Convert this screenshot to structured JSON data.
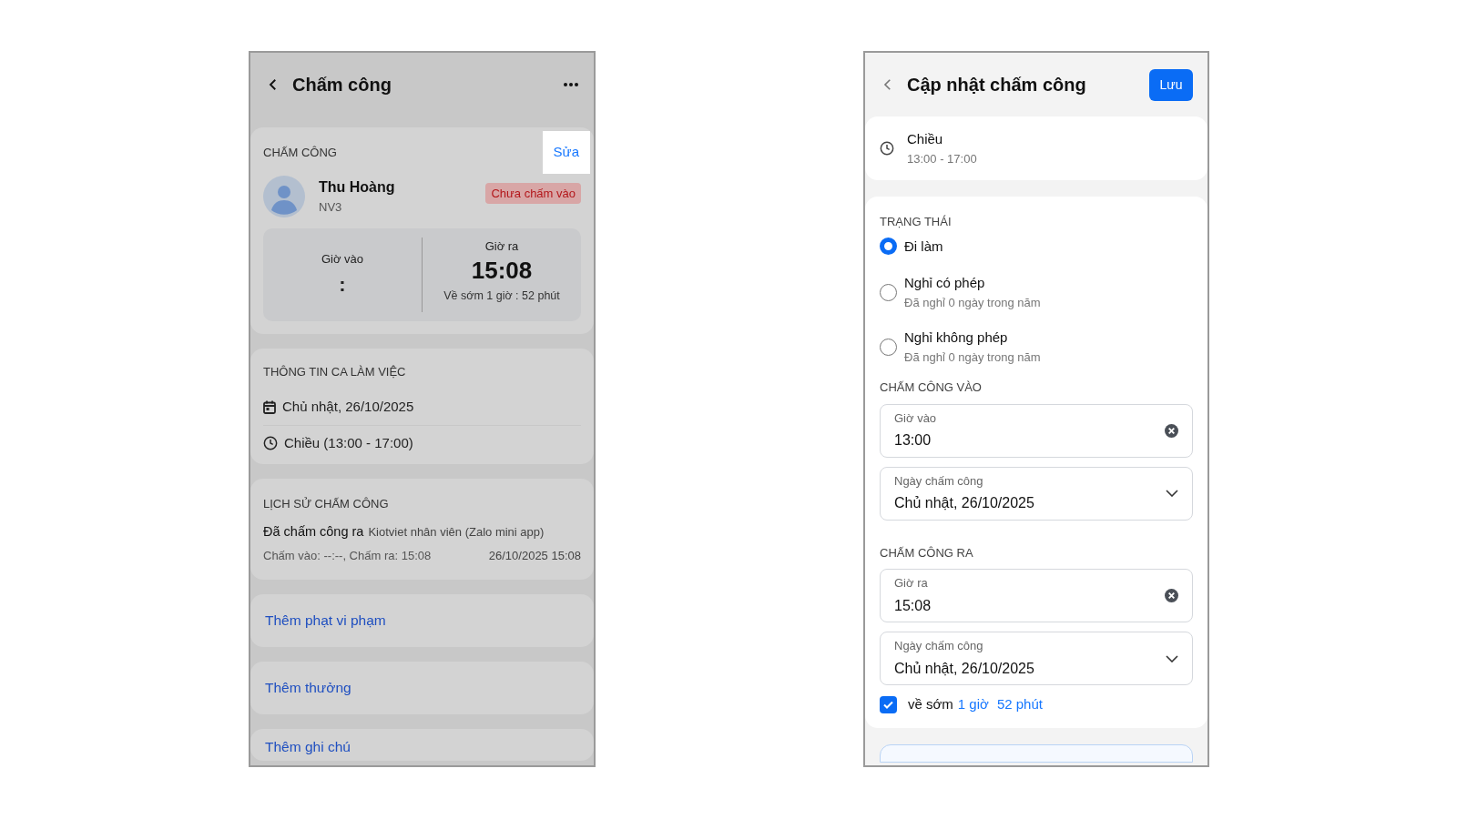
{
  "attendance_screen": {
    "dimmed": true,
    "title": "Chấm công",
    "attendance_card": {
      "heading": "CHẤM CÔNG",
      "edit_link": {
        "label": "Sửa",
        "highlighted": true
      },
      "employee": {
        "name": "Thu Hoàng",
        "code": "NV3"
      },
      "status_badge": "Chưa chấm vào",
      "clock_in": {
        "label": "Giờ vào",
        "value": ":"
      },
      "clock_out": {
        "label": "Giờ ra",
        "value": "15:08",
        "note": "Về sớm 1 giờ : 52 phút"
      }
    },
    "shift_card": {
      "heading": "THÔNG TIN CA LÀM VIỆC",
      "date": "Chủ nhật, 26/10/2025",
      "shift": "Chiều (13:00 - 17:00)"
    },
    "history_card": {
      "heading": "LỊCH SỬ CHẤM CÔNG",
      "entries": [
        {
          "action": "Đã chấm công ra",
          "source": "Kiotviet nhân viên (Zalo mini app)",
          "detail": "Chấm vào: --:--, Chấm ra: 15:08",
          "timestamp": "26/10/2025 15:08"
        }
      ]
    },
    "actions": [
      "Thêm phạt vi phạm",
      "Thêm thưởng",
      "Thêm ghi chú"
    ]
  },
  "edit_screen": {
    "title": "Cập nhật chấm công",
    "save_button": "Lưu",
    "shift": {
      "name": "Chiều",
      "time": "13:00 - 17:00"
    },
    "status": {
      "heading": "TRẠNG THÁI",
      "options": [
        {
          "label": "Đi làm",
          "selected": true
        },
        {
          "label": "Nghỉ có phép",
          "note": "Đã nghỉ 0 ngày trong năm",
          "selected": false
        },
        {
          "label": "Nghỉ không phép",
          "note": "Đã nghỉ 0 ngày trong năm",
          "selected": false
        }
      ]
    },
    "sections": [
      {
        "heading": "CHẤM CÔNG VÀO",
        "fields": [
          {
            "kind": "time",
            "label": "Giờ vào",
            "value": "13:00"
          },
          {
            "kind": "date",
            "label": "Ngày chấm công",
            "value": "Chủ nhật, 26/10/2025"
          }
        ]
      },
      {
        "heading": "CHẤM CÔNG RA",
        "fields": [
          {
            "kind": "time",
            "label": "Giờ ra",
            "value": "15:08"
          },
          {
            "kind": "date",
            "label": "Ngày chấm công",
            "value": "Chủ nhật, 26/10/2025"
          }
        ]
      }
    ],
    "early_leave": {
      "checked": true,
      "prefix": "về sớm",
      "hours": "1 giờ",
      "minutes": "52 phút"
    }
  }
}
